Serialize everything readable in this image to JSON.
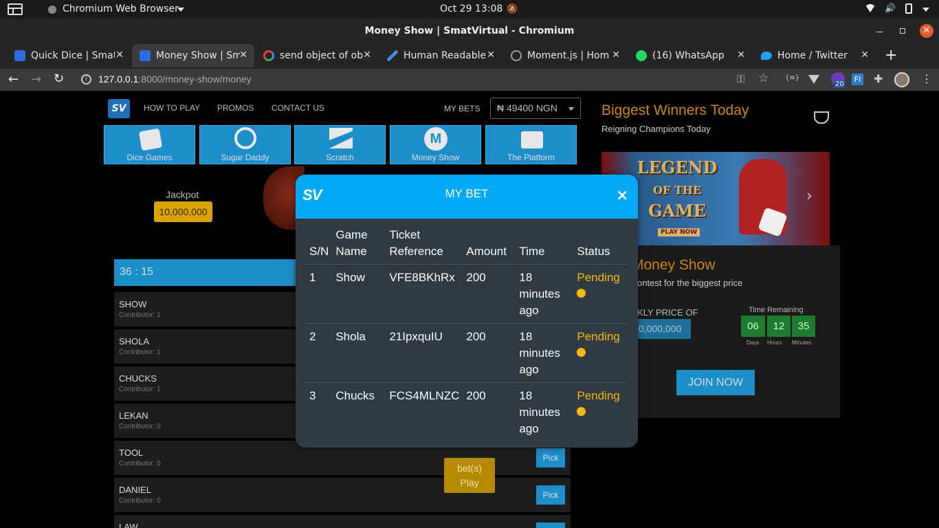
{
  "os": {
    "app": "Chromium Web Browser",
    "clock": "Oct 29  13:08"
  },
  "window": {
    "title": "Money Show | SmatVirtual - Chromium"
  },
  "tabs": [
    {
      "label": "Quick Dice | Smat",
      "color": "#2b6ce0"
    },
    {
      "label": "Money Show | Sm",
      "color": "#2b6ce0"
    },
    {
      "label": "send object of ob",
      "color": "#ffffff"
    },
    {
      "label": "Human Readable",
      "color": "#4a90e2"
    },
    {
      "label": "Moment.js | Hom",
      "color": "#9aa0a6"
    },
    {
      "label": "(16) WhatsApp",
      "color": "#25d366"
    },
    {
      "label": "Home / Twitter",
      "color": "#1da1f2"
    }
  ],
  "address": {
    "host": "127.0.0.1",
    "rest": ":8000/money-show/money",
    "badge": "20"
  },
  "site": {
    "logo": "SV",
    "nav": [
      "HOW TO PLAY",
      "PROMOS",
      "CONTACT US"
    ],
    "mybets": "MY BETS",
    "balance": "₦ 49400 NGN",
    "categories": [
      "Dice Games",
      "Sugar Daddy",
      "Scratch",
      "Money Show",
      "The Platform"
    ],
    "jackpot_label": "Jackpot",
    "jackpot_value": "10,000,000",
    "timer": "36 : 15",
    "contestants": [
      {
        "name": "SHOW",
        "contrib": "Contributor: 1"
      },
      {
        "name": "SHOLA",
        "contrib": "Contributor: 1"
      },
      {
        "name": "CHUCKS",
        "contrib": "Contributor: 1"
      },
      {
        "name": "LEKAN",
        "contrib": "Contributor: 0"
      },
      {
        "name": "TOOL",
        "contrib": "Contributor: 0"
      },
      {
        "name": "DANIEL",
        "contrib": "Contributor: 0"
      },
      {
        "name": "LAW",
        "contrib": ""
      }
    ],
    "pick": "Pick",
    "bet_line1": "bet(s)",
    "bet_line2": "Play"
  },
  "sidebar": {
    "title": "Biggest Winners Today",
    "subtitle": "Reigning Champions Today",
    "banner_line1": "LEGEND",
    "banner_line2": "OF THE",
    "banner_line3": "GAME",
    "banner_btn": "PLAY NOW",
    "card_title": "Money Show",
    "card_sub": "ontest for the biggest price",
    "price_label": "KLY PRICE OF",
    "price_value": "0,000,000",
    "time_label": "Time Remaining",
    "days": "06",
    "hours": "12",
    "minutes": "35",
    "days_l": "Days",
    "hours_l": "Hours",
    "minutes_l": "Minutes",
    "join": "JOIN NOW"
  },
  "modal": {
    "logo": "SV",
    "title": "MY BET",
    "close": "×",
    "headers": {
      "sn": "S/N",
      "game1": "Game",
      "game2": "Name",
      "ticket1": "Ticket",
      "ticket2": "Reference",
      "amount": "Amount",
      "time": "Time",
      "status": "Status"
    },
    "rows": [
      {
        "sn": "1",
        "game": "Show",
        "ref": "VFE8BKhRx",
        "amount": "200",
        "t1": "18",
        "t2": "minutes",
        "t3": "ago",
        "status": "Pending"
      },
      {
        "sn": "2",
        "game": "Shola",
        "ref": "21IpxquIU",
        "amount": "200",
        "t1": "18",
        "t2": "minutes",
        "t3": "ago",
        "status": "Pending"
      },
      {
        "sn": "3",
        "game": "Chucks",
        "ref": "FCS4MLNZC",
        "amount": "200",
        "t1": "18",
        "t2": "minutes",
        "t3": "ago",
        "status": "Pending"
      }
    ]
  }
}
